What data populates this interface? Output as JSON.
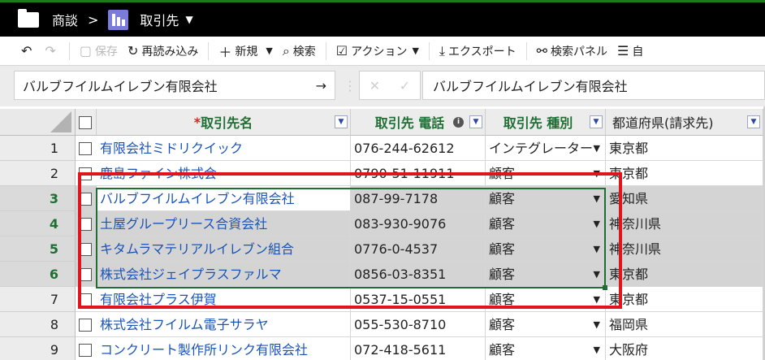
{
  "breadcrumb": {
    "parent": "商談",
    "separator": ">",
    "current": "取引先",
    "caret": "▼"
  },
  "toolbar": {
    "undo": "↶",
    "redo": "↷",
    "save": "保存",
    "reload": "再読み込み",
    "new": "新規",
    "new_caret": "▼",
    "search": "検索",
    "action": "アクション",
    "action_caret": "▼",
    "export": "エクスポート",
    "search_panel": "検索パネル",
    "more": "自"
  },
  "formula_bar": {
    "name_box": "バルブフイルムイレブン有限会社",
    "arrow": "→",
    "cancel": "✕",
    "confirm": "✓",
    "value": "バルブフイルムイレブン有限会社"
  },
  "columns": [
    {
      "required_mark": "*",
      "label": "取引先名"
    },
    {
      "label": "取引先 電話",
      "info": "i"
    },
    {
      "label": "取引先 種別"
    },
    {
      "label": "都道府県(請求先)"
    }
  ],
  "filter_glyph": "▼",
  "rows": [
    {
      "num": "1",
      "name": "有限会社ミドリクイック",
      "phone": "076-244-62612",
      "type": "インテグレーター",
      "pref": "東京都",
      "selected": false
    },
    {
      "num": "2",
      "name": "鹿島ファイン株式会",
      "phone": "0790-51-11911",
      "type": "顧客",
      "pref": "東京都",
      "selected": false
    },
    {
      "num": "3",
      "name": "バルブフイルムイレブン有限会社",
      "phone": "087-99-7178",
      "type": "顧客",
      "pref": "愛知県",
      "selected": true
    },
    {
      "num": "4",
      "name": "土屋グループリース合資会社",
      "phone": "083-930-9076",
      "type": "顧客",
      "pref": "神奈川県",
      "selected": true
    },
    {
      "num": "5",
      "name": "キタムラマテリアルイレブン組合",
      "phone": "0776-0-4537",
      "type": "顧客",
      "pref": "神奈川県",
      "selected": true
    },
    {
      "num": "6",
      "name": "株式会社ジェイプラスファルマ",
      "phone": "0856-03-8351",
      "type": "顧客",
      "pref": "東京都",
      "selected": true
    },
    {
      "num": "7",
      "name": "有限会社プラス伊賀",
      "phone": "0537-15-0551",
      "type": "顧客",
      "pref": "東京都",
      "selected": false
    },
    {
      "num": "8",
      "name": "株式会社フイルム電子サラヤ",
      "phone": "055-530-8710",
      "type": "顧客",
      "pref": "福岡県",
      "selected": false
    },
    {
      "num": "9",
      "name": "コンクリート製作所リンク有限会社",
      "phone": "072-418-5611",
      "type": "顧客",
      "pref": "大阪府",
      "selected": false
    }
  ],
  "dropdown_glyph": "▼",
  "colors": {
    "header_text": "#1f6f34",
    "link": "#1a54b8",
    "annotation": "#e0141c",
    "title_bar": "#000000"
  }
}
